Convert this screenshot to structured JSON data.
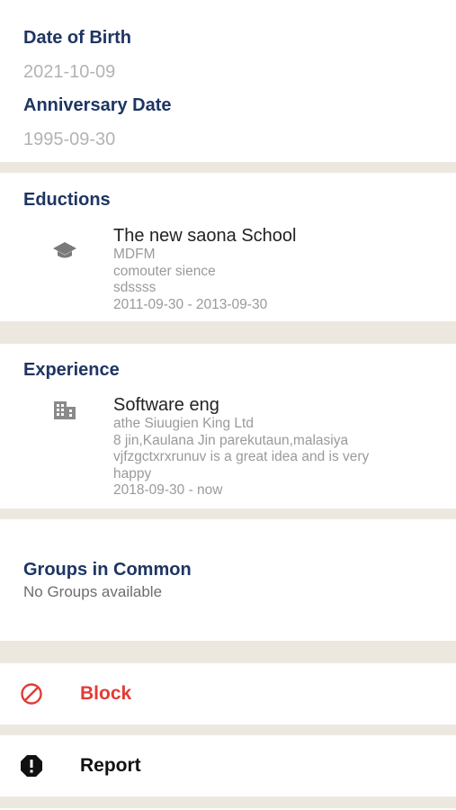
{
  "personal": {
    "dob_label": "Date of Birth",
    "dob_value": "2021-10-09",
    "anniversary_label": "Anniversary Date",
    "anniversary_value": "1995-09-30"
  },
  "educations": {
    "heading": "Eductions",
    "icon": "graduation-cap-icon",
    "items": [
      {
        "title": "The new saona School",
        "lines": [
          "MDFM",
          "comouter sience",
          "sdssss",
          "2011-09-30 - 2013-09-30"
        ]
      }
    ]
  },
  "experience": {
    "heading": "Experience",
    "icon": "building-icon",
    "items": [
      {
        "title": "Software eng",
        "lines": [
          "athe Siuugien King Ltd",
          "8 jin,Kaulana Jin parekutaun,malasiya",
          "vjfzgctxrxrunuv is a great idea and is very",
          "happy",
          "2018-09-30 -  now"
        ]
      }
    ]
  },
  "groups": {
    "heading": "Groups in Common",
    "empty_text": "No Groups available"
  },
  "actions": {
    "block_label": "Block",
    "block_icon": "block-icon",
    "block_color": "#e33b36",
    "report_label": "Report",
    "report_icon": "report-icon"
  },
  "colors": {
    "heading": "#1e3563",
    "divider": "#ece8e0",
    "muted": "#b3b3b3"
  }
}
